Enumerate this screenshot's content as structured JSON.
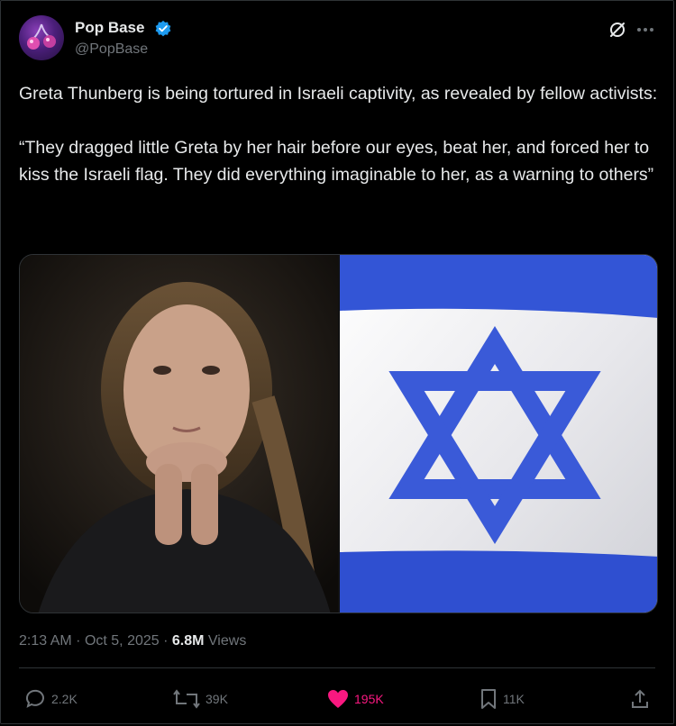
{
  "author": {
    "name": "Pop Base",
    "handle": "@PopBase"
  },
  "tweet": {
    "text_line1": "Greta Thunberg is being tortured in Israeli captivity, as revealed by fellow activists:",
    "text_line2": "“They dragged little Greta by her hair before our eyes, beat her, and forced her to kiss the Israeli flag. They did everything imaginable to her, as a warning to others”"
  },
  "meta": {
    "time": "2:13 AM",
    "separator": "·",
    "date": "Oct 5, 2025",
    "views_count": "6.8M",
    "views_label": "Views"
  },
  "actions": {
    "replies": "2.2K",
    "reposts": "39K",
    "likes": "195K",
    "bookmarks": "11K"
  },
  "colors": {
    "background": "#000000",
    "text": "#e7e9ea",
    "muted": "#71767b",
    "like": "#f91880",
    "verified": "#1d9bf0",
    "flag_blue": "#2f4fd0"
  },
  "icons": [
    "avatar-logo",
    "verified-badge-icon",
    "grok-icon",
    "more-icon",
    "reply-icon",
    "repost-icon",
    "like-icon",
    "bookmark-icon",
    "share-icon"
  ]
}
